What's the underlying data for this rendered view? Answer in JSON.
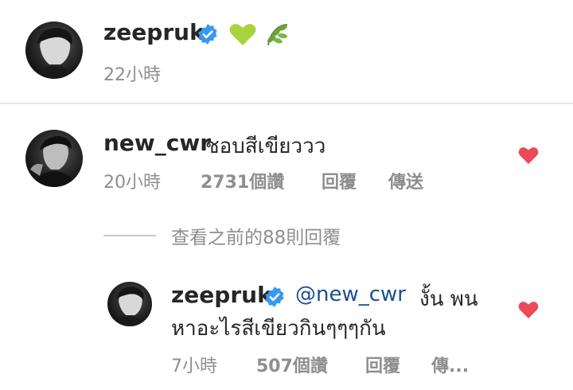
{
  "caption": {
    "username": "zeepruk",
    "emoji": "💚🌿",
    "time": "22小時"
  },
  "comment": {
    "username": "new_cwr",
    "text": "ชอบสีเขียววว",
    "time": "20小時",
    "likes": "2731個讚",
    "reply": "回覆",
    "send": "傳送"
  },
  "view_previous": "查看之前的88則回覆",
  "reply": {
    "username": "zeepruk",
    "mention": "@new_cwr",
    "text_line1": "งั้น พน",
    "text_line2": "หาอะไรสีเขียวกินๆๆๆกัน",
    "time": "7小時",
    "likes": "507個讚",
    "reply": "回覆",
    "send": "傳..."
  },
  "colors": {
    "heart": "#ed4956",
    "verified": "#3897f0",
    "muted": "#8e8e8e",
    "mention": "#1d4f91"
  }
}
